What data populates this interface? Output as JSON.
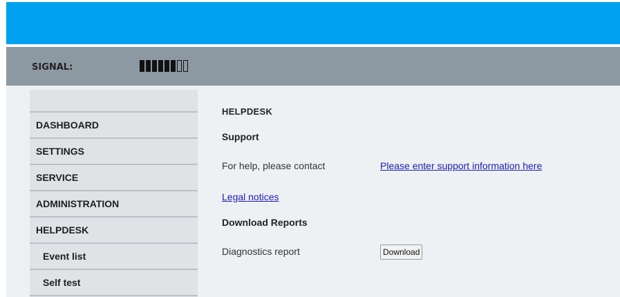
{
  "header": {
    "signal_label": "SIGNAL:",
    "signal_level": {
      "filled": 6,
      "total": 8
    }
  },
  "sidebar": {
    "items": [
      {
        "label": "DASHBOARD"
      },
      {
        "label": "SETTINGS"
      },
      {
        "label": "SERVICE"
      },
      {
        "label": "ADMINISTRATION"
      },
      {
        "label": "HELPDESK"
      },
      {
        "label": "Event list"
      },
      {
        "label": "Self test"
      }
    ]
  },
  "main": {
    "title": "HELPDESK",
    "support_heading": "Support",
    "contact_text": "For help, please contact",
    "support_link": "Please enter support information here",
    "legal_link": "Legal notices",
    "reports_heading": "Download Reports",
    "diagnostics_label": "Diagnostics report",
    "download_button": "Download"
  },
  "colors": {
    "topbar": "#00a2ef",
    "signalbar": "#8d99a2",
    "content_bg": "#eef1f3",
    "sidebar_bg": "#dfe3e6",
    "link": "#1b1bb3"
  }
}
